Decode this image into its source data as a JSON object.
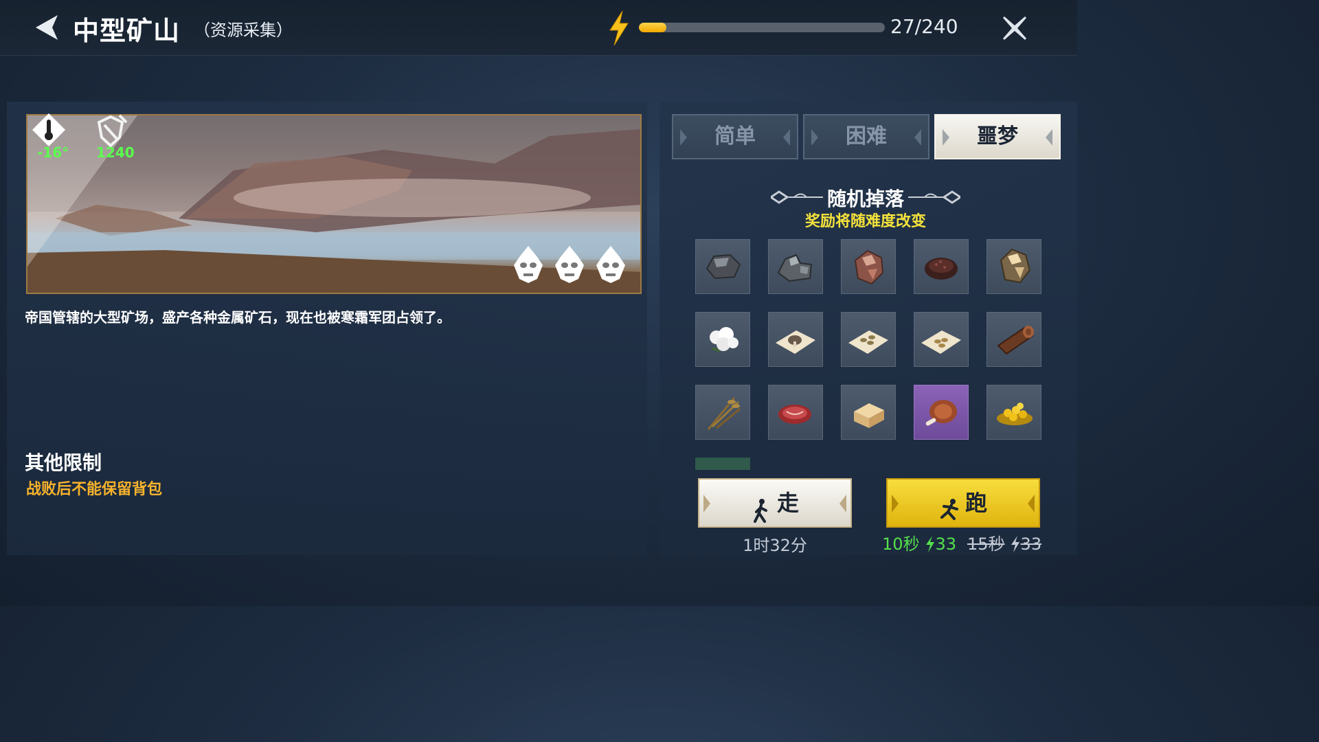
{
  "header": {
    "title": "中型矿山",
    "subtitle": "（资源采集）",
    "energy_text": "27/240",
    "energy_fraction": 0.1125
  },
  "banner": {
    "temperature": "-16°",
    "power": "1240",
    "threat_icons": [
      "skull-icon",
      "skull-icon",
      "skull-icon"
    ]
  },
  "description": "帝国管辖的大型矿场，盛产各种金属矿石，现在也被寒霜军团占领了。",
  "limits": {
    "title": "其他限制",
    "text": "战败后不能保留背包"
  },
  "difficulty_tabs": [
    {
      "label": "简单",
      "active": false
    },
    {
      "label": "困难",
      "active": false
    },
    {
      "label": "噩梦",
      "active": true
    }
  ],
  "drops": {
    "title": "随机掉落",
    "subtitle": "奖励将随难度改变",
    "items": [
      "iron-ore-icon",
      "stone-ore-icon",
      "copper-ore-icon",
      "dark-gravel-icon",
      "gold-ore-icon",
      "cotton-icon",
      "mushroom-seed-icon",
      "seed-pack-icon",
      "seed-pack-icon",
      "wood-log-icon",
      "wheat-icon",
      "raw-meat-icon",
      "flour-block-icon",
      "ham-icon",
      "gold-coins-icon"
    ]
  },
  "actions": {
    "walk_label": "走",
    "walk_time": "1时32分",
    "run_label": "跑",
    "run_time": "10秒",
    "run_cost": "33",
    "run_old_time": "15秒",
    "run_old_cost": "33"
  },
  "colors": {
    "accent_yellow": "#f2b90f",
    "green_value": "#5bff4f",
    "warning_orange": "#f7b32b"
  }
}
